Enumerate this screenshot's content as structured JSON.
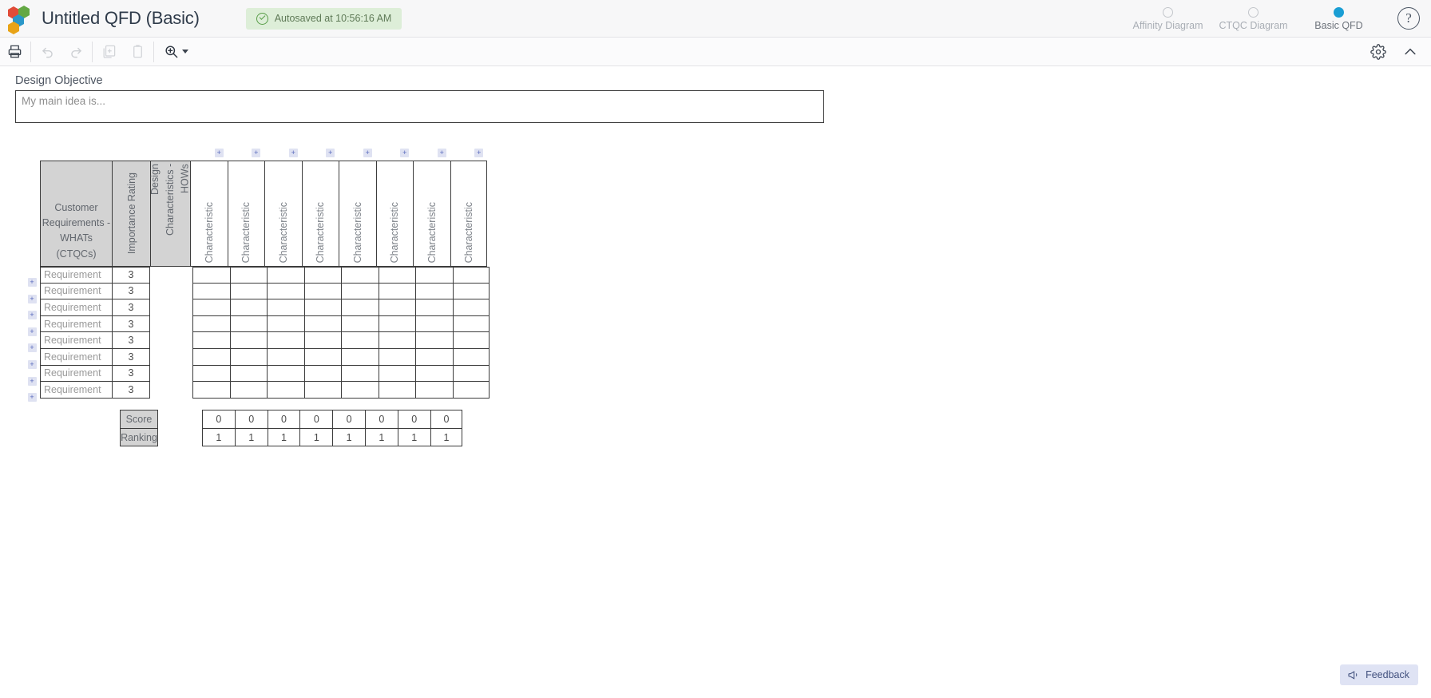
{
  "header": {
    "logo_icon": "hexagon-cluster-logo",
    "title": "Untitled QFD (Basic)",
    "autosave": {
      "icon": "check-circle-icon",
      "text": "Autosaved at 10:56:16 AM"
    },
    "tabs": [
      {
        "label": "Affinity Diagram",
        "active": false
      },
      {
        "label": "CTQC Diagram",
        "active": false
      },
      {
        "label": "Basic QFD",
        "active": true
      }
    ],
    "help_label": "?",
    "accent_color": "#1a9ed4"
  },
  "toolbar": {
    "buttons": [
      {
        "name": "print",
        "icon": "printer-icon",
        "disabled": false
      },
      {
        "name": "undo",
        "icon": "undo-arrow-icon",
        "disabled": true
      },
      {
        "name": "redo",
        "icon": "redo-arrow-icon",
        "disabled": true
      },
      {
        "name": "duplicate",
        "icon": "copy-plus-icon",
        "disabled": true
      },
      {
        "name": "paste",
        "icon": "clipboard-icon",
        "disabled": true
      },
      {
        "name": "zoom",
        "icon": "zoom-in-icon",
        "disabled": false
      }
    ],
    "right_buttons": [
      {
        "name": "settings",
        "icon": "gear-icon"
      },
      {
        "name": "collapse",
        "icon": "chevron-up-icon"
      }
    ]
  },
  "objective": {
    "label": "Design Objective",
    "placeholder": "My main idea is...",
    "value": ""
  },
  "matrix": {
    "headers": {
      "whats": "Customer Requirements - WHATs (CTQCs)",
      "importance": "Importance Rating",
      "hows": "Design Characteristics - HOWs",
      "characteristic": "Characteristic"
    },
    "add_row_label": "+",
    "add_column_label": "+",
    "column_count": 8,
    "rows": [
      {
        "requirement": "Requirement",
        "importance": "3"
      },
      {
        "requirement": "Requirement",
        "importance": "3"
      },
      {
        "requirement": "Requirement",
        "importance": "3"
      },
      {
        "requirement": "Requirement",
        "importance": "3"
      },
      {
        "requirement": "Requirement",
        "importance": "3"
      },
      {
        "requirement": "Requirement",
        "importance": "3"
      },
      {
        "requirement": "Requirement",
        "importance": "3"
      },
      {
        "requirement": "Requirement",
        "importance": "3"
      }
    ],
    "summary": [
      {
        "label": "Score",
        "values": [
          "0",
          "0",
          "0",
          "0",
          "0",
          "0",
          "0",
          "0"
        ]
      },
      {
        "label": "Ranking",
        "values": [
          "1",
          "1",
          "1",
          "1",
          "1",
          "1",
          "1",
          "1"
        ]
      }
    ]
  },
  "feedback": {
    "icon": "megaphone-icon",
    "label": "Feedback"
  }
}
